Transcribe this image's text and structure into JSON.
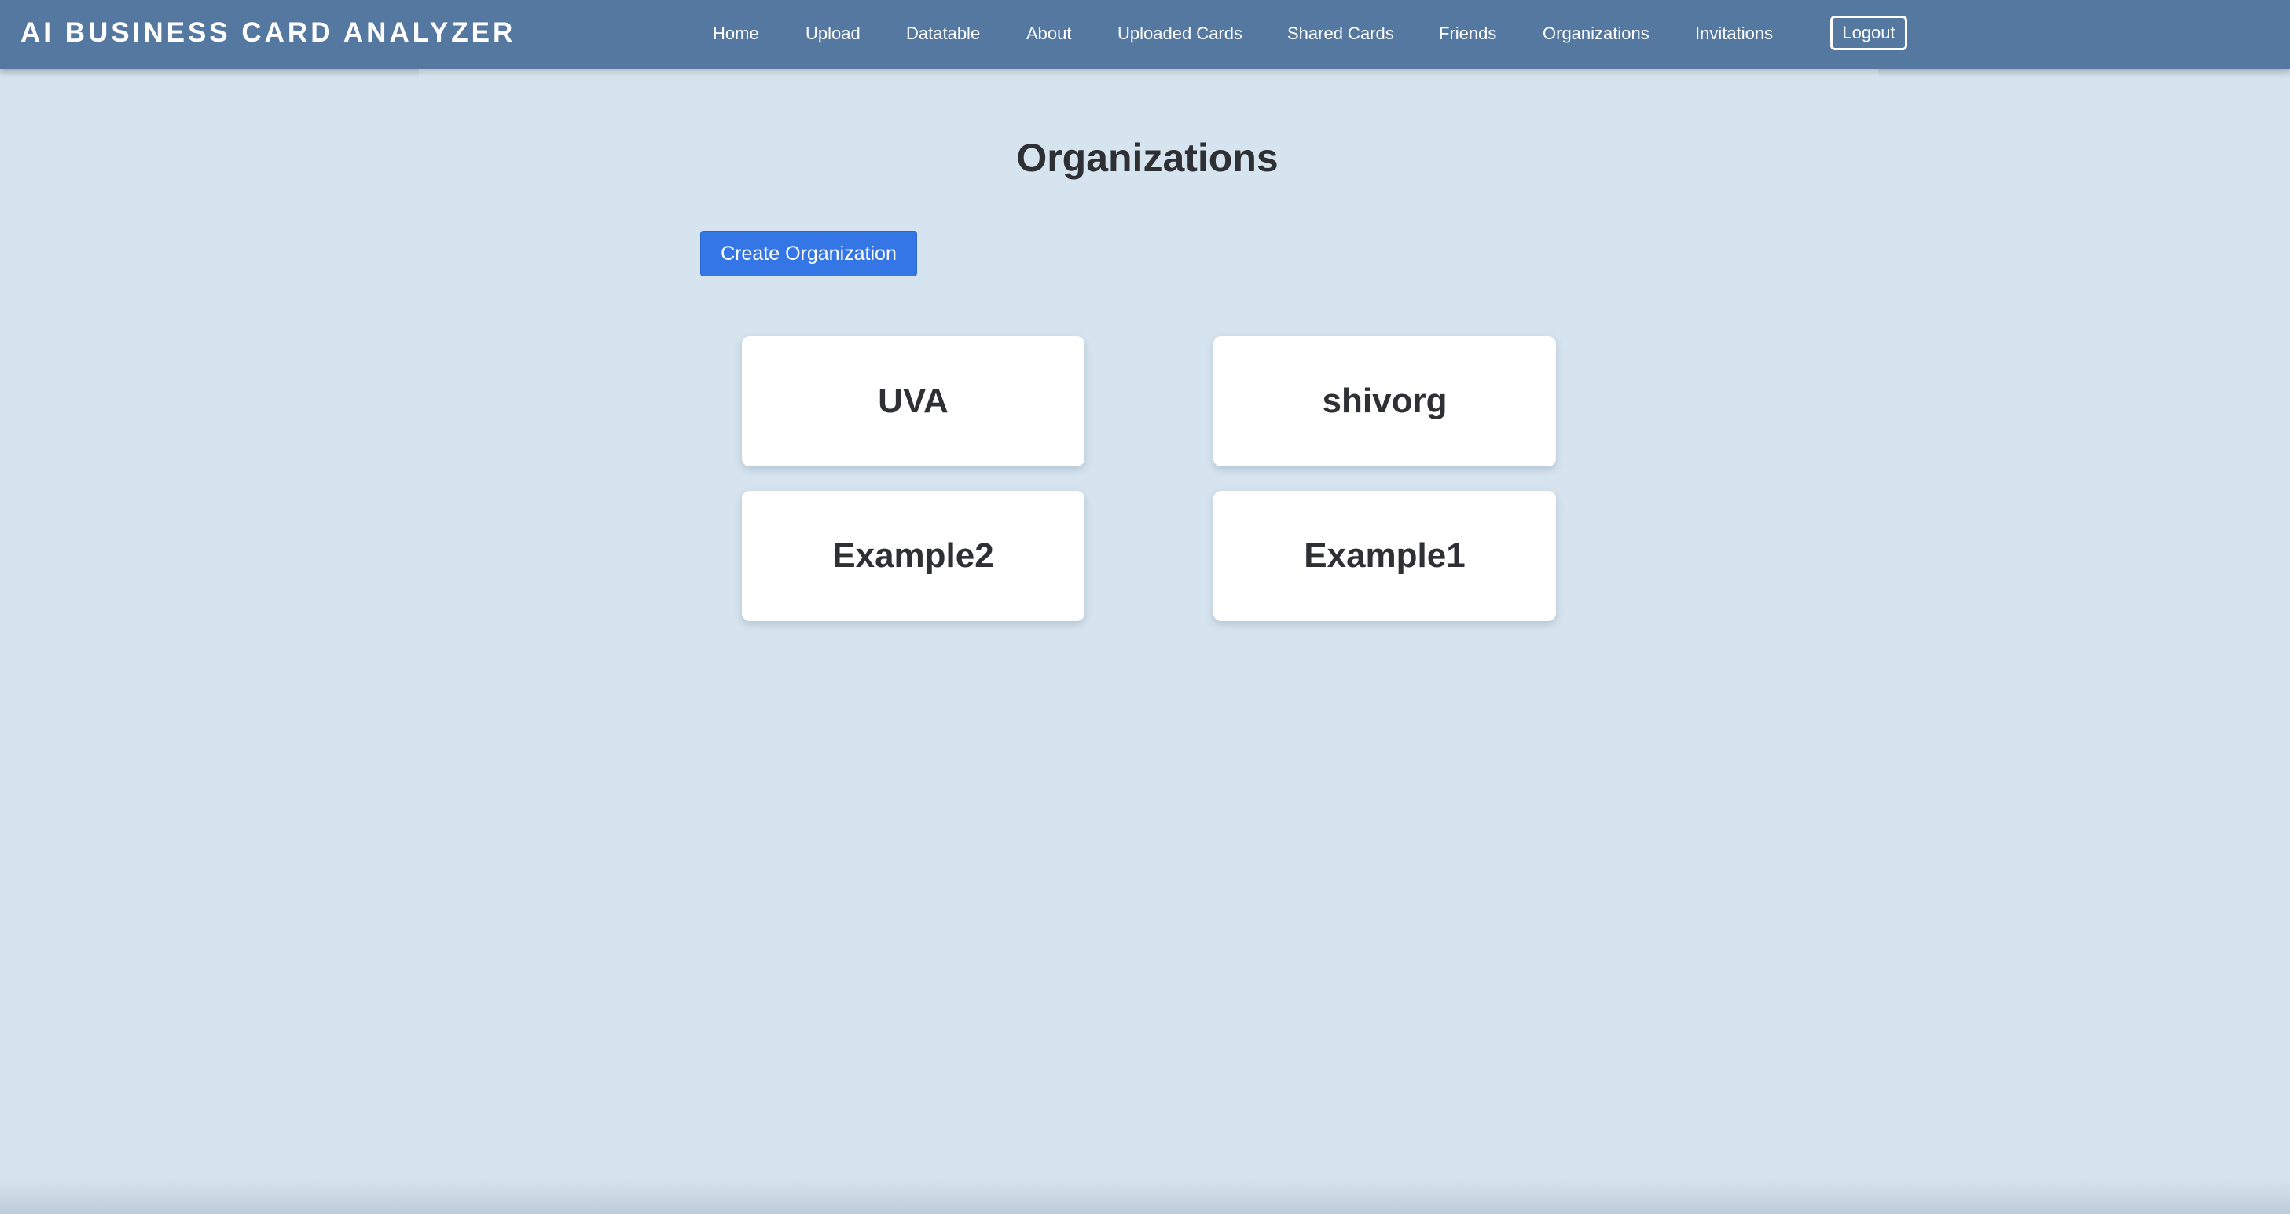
{
  "navbar": {
    "brand": "AI BUSINESS CARD ANALYZER",
    "links": [
      {
        "label": "Home"
      },
      {
        "label": "Upload"
      },
      {
        "label": "Datatable"
      },
      {
        "label": "About"
      },
      {
        "label": "Uploaded Cards"
      },
      {
        "label": "Shared Cards"
      },
      {
        "label": "Friends"
      },
      {
        "label": "Organizations"
      },
      {
        "label": "Invitations"
      }
    ],
    "logout_label": "Logout"
  },
  "main": {
    "title": "Organizations",
    "create_button_label": "Create Organization",
    "organizations": [
      {
        "name": "UVA"
      },
      {
        "name": "shivorg"
      },
      {
        "name": "Example2"
      },
      {
        "name": "Example1"
      }
    ]
  },
  "colors": {
    "navbar": "#5578a0",
    "background": "#d6e4ef",
    "primary_button": "#3476e6",
    "card": "#ffffff",
    "text_dark": "#2f3033"
  }
}
